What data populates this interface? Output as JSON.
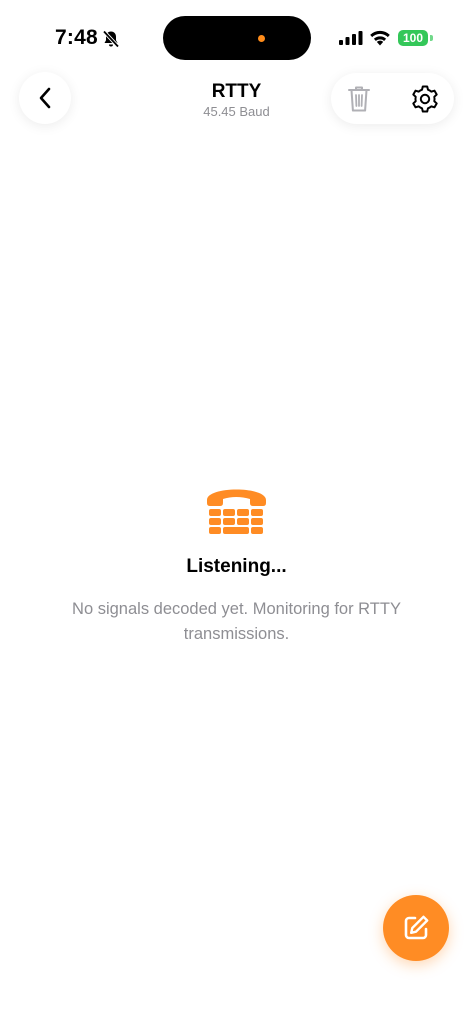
{
  "status_bar": {
    "time": "7:48",
    "battery": "100",
    "icons": [
      "bell-slash-icon",
      "signal-icon",
      "wifi-icon",
      "battery-icon"
    ]
  },
  "header": {
    "title": "RTTY",
    "subtitle": "45.45 Baud",
    "back_icon": "chevron-left-icon",
    "actions": [
      "trash-icon",
      "gear-icon"
    ]
  },
  "empty_state": {
    "icon": "tty-phone-icon",
    "heading": "Listening...",
    "message": "No signals decoded yet. Monitoring for RTTY transmissions."
  },
  "fab": {
    "icon": "compose-icon"
  },
  "colors": {
    "accent": "#ff8c24",
    "secondary_text": "#8e8e93",
    "battery": "#34c759"
  }
}
